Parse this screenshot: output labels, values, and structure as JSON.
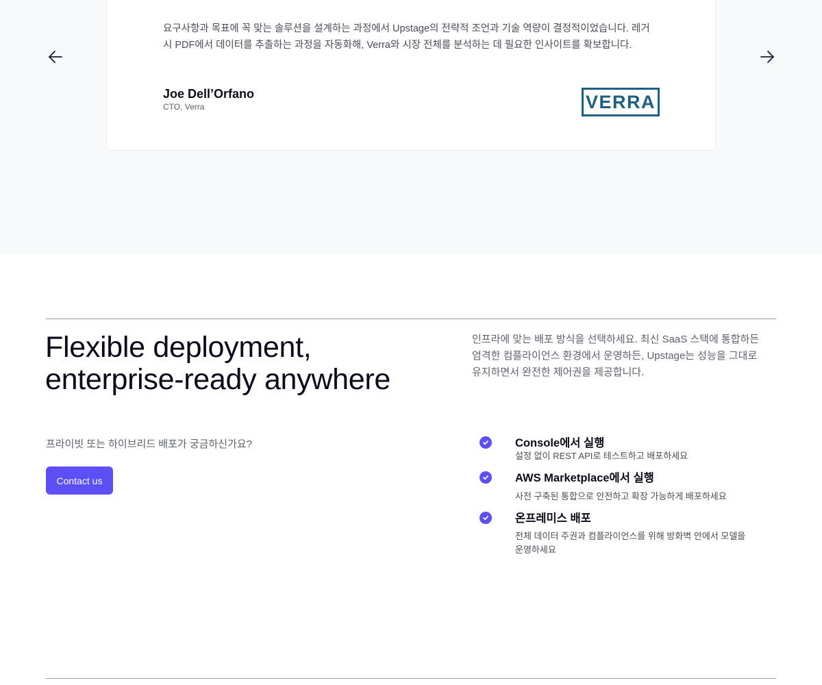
{
  "testimonial": {
    "headline_partial": "— — — — — — — — — — — — — — — —",
    "quote": "요구사항과 목표에 꼭 맞는 솔루션을 설계하는 과정에서 Upstage의 전략적 조언과 기술 역량이 결정적이었습니다. 레거시 PDF에서 데이터를 추출하는 과정을 자동화해, Verra와 시장 전체를 분석하는 데 필요한 인사이트를 확보합니다.",
    "author_name": "Joe Dell’Orfano",
    "author_role": "CTO, Verra",
    "logo_text": "VERRA",
    "prev_icon": "arrow-left-icon",
    "next_icon": "arrow-right-icon"
  },
  "deployment": {
    "heading_line1": "Flexible deployment,",
    "heading_line2": "enterprise-ready anywhere",
    "description": "인프라에 맞는 배포 방식을 선택하세요. 최신 SaaS 스택에 통합하든 엄격한 컴플라이언스 환경에서 운영하든, Upstage는 성능을 그대로 유지하면서 완전한 제어권을 제공합니다.",
    "question": "프라이빗 또는 하이브리드 배포가 궁금하신가요?",
    "contact_label": "Contact us",
    "options": [
      {
        "icon": "check-circle-icon",
        "title": "Console에서 실행",
        "desc": "설정 없이 REST API로 테스트하고 배포하세요"
      },
      {
        "icon": "check-circle-icon",
        "title": "AWS Marketplace에서 실행",
        "desc": "사전 구축된 통합으로 안전하고 확장 가능하게 배포하세요"
      },
      {
        "icon": "check-circle-icon",
        "title": "온프레미스 배포",
        "desc": "전체 데이터 주권과 컴플라이언스를 위해 방화벽 안에서 모델을 운영하세요"
      }
    ]
  },
  "colors": {
    "accent": "#5b4ff5",
    "verra_blue": "#1c5f7e",
    "section_bg": "#f8f9fb"
  }
}
